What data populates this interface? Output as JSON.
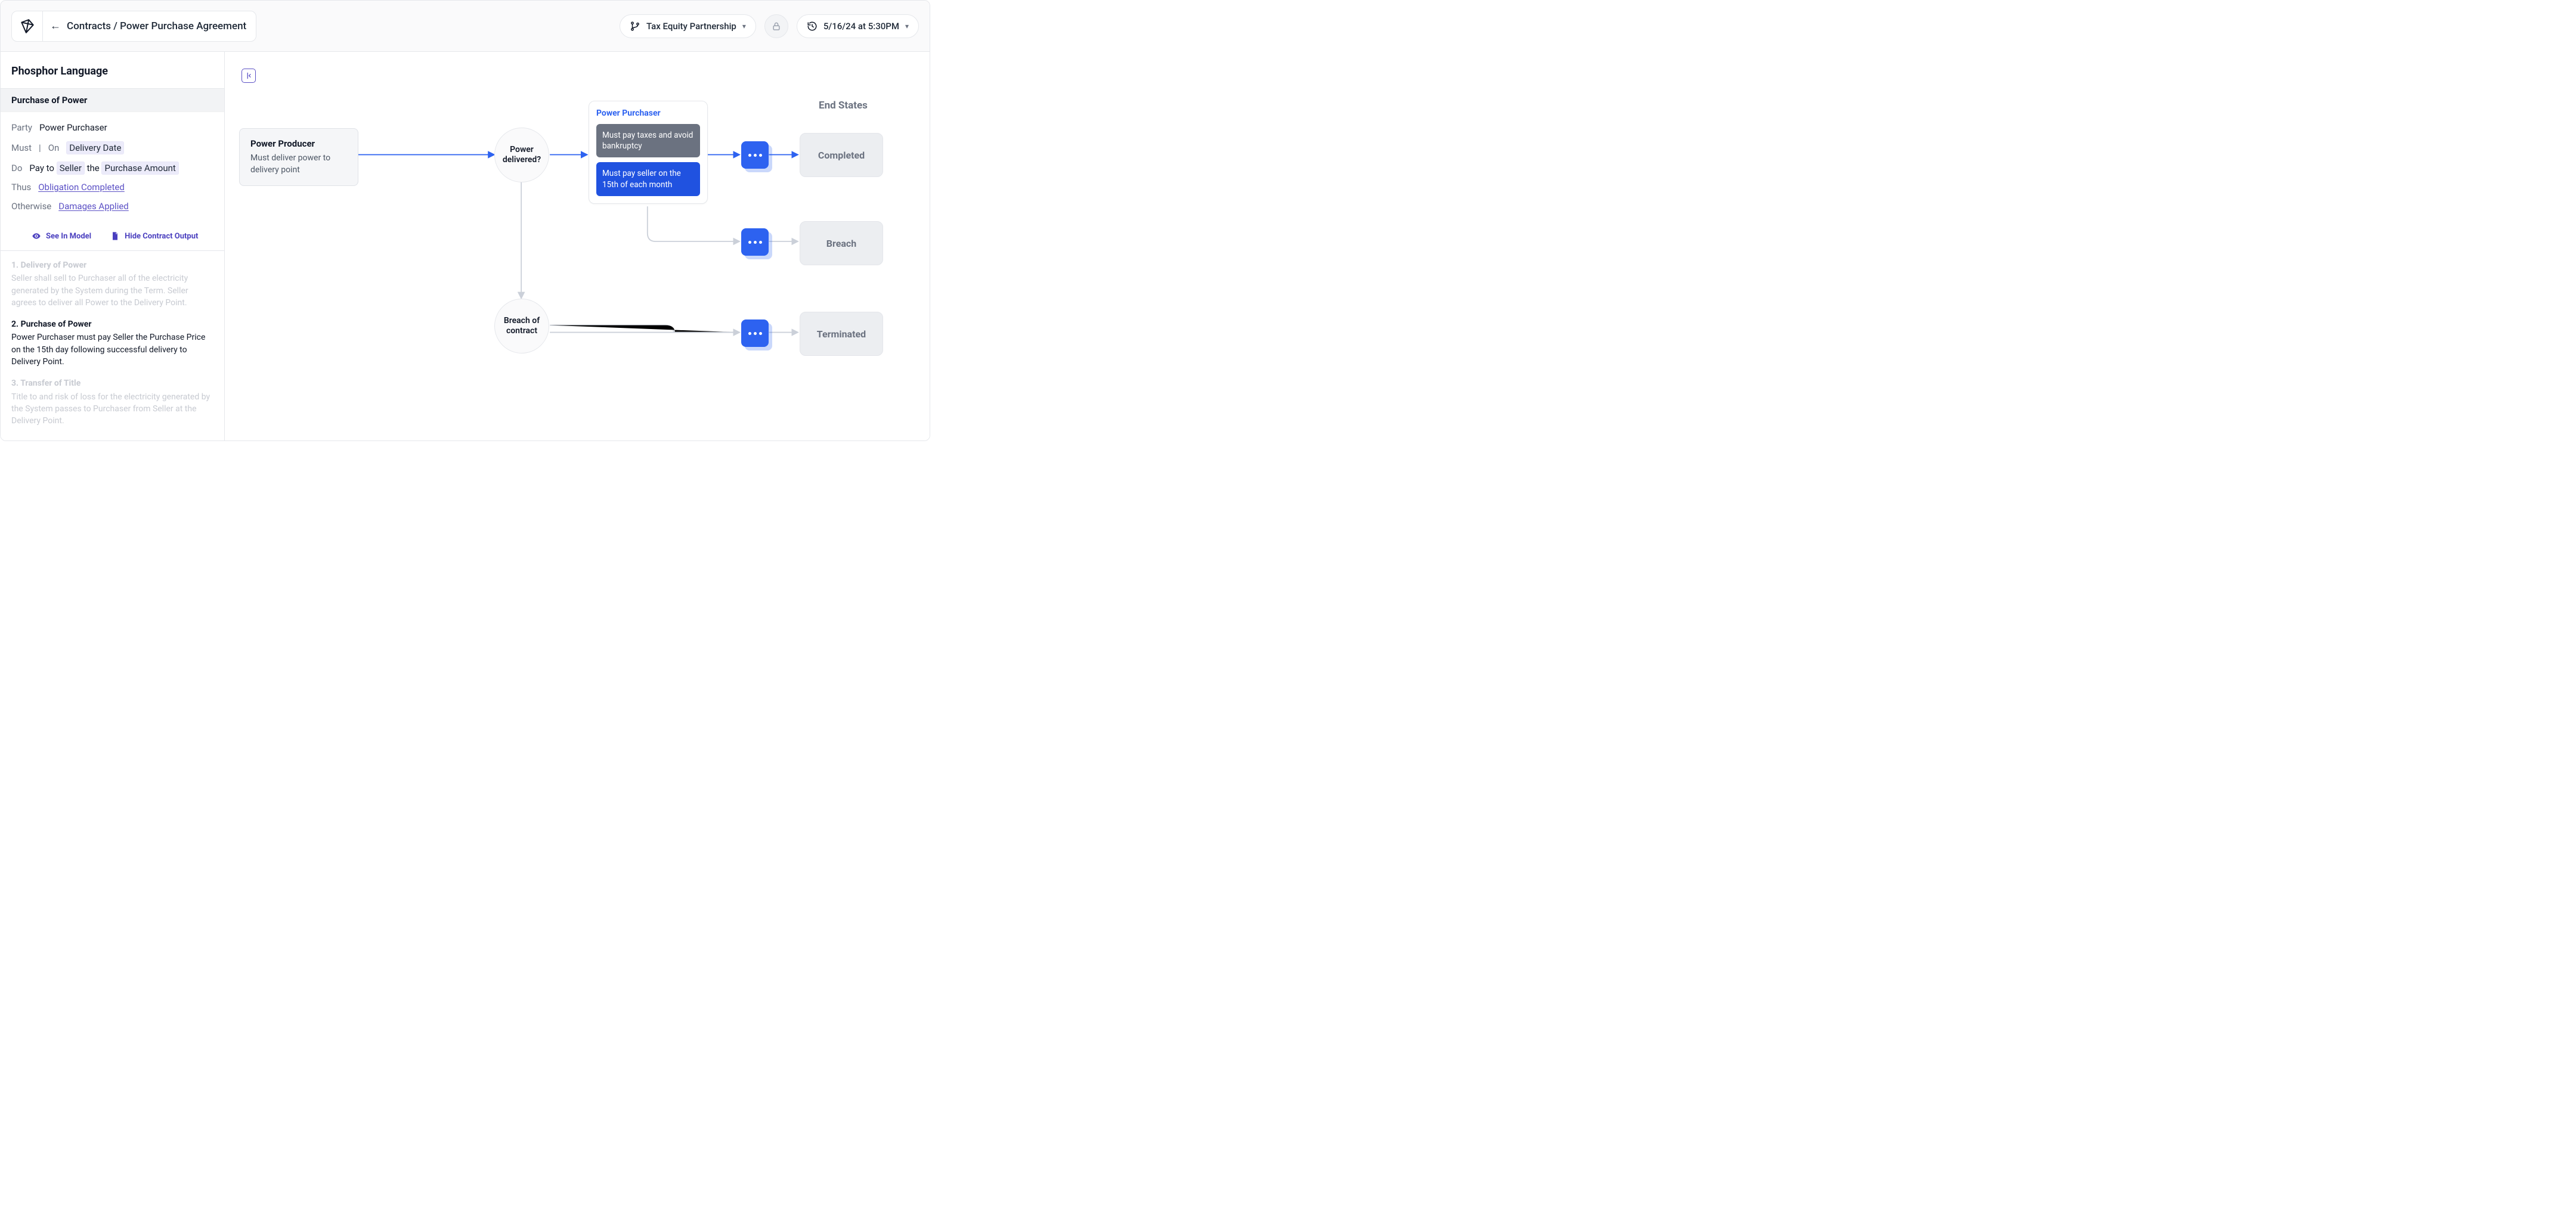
{
  "header": {
    "breadcrumb_prefix": "Contracts",
    "breadcrumb_sep": " / ",
    "breadcrumb_current": "Power Purchase Agreement",
    "branch_label": "Tax Equity Partnership",
    "timestamp": "5/16/24 at 5:30PM"
  },
  "sidebar": {
    "title": "Phosphor Language",
    "section": "Purchase of Power",
    "rows": {
      "party_k": "Party",
      "party_v": "Power Purchaser",
      "must_k": "Must",
      "on_k": "On",
      "on_v": "Delivery Date",
      "do_k": "Do",
      "do_pre": "Pay to ",
      "do_chip1": "Seller",
      "do_mid": " the ",
      "do_chip2": "Purchase Amount",
      "thus_k": "Thus",
      "thus_v": "Obligation Completed",
      "otherwise_k": "Otherwise",
      "otherwise_v": "Damages Applied"
    },
    "actions": {
      "see_in_model": "See In Model",
      "hide_output": "Hide Contract Output"
    },
    "clauses": [
      {
        "title": "1. Delivery of Power",
        "body": "Seller shall sell to Purchaser all of the electricity generated by the System during the Term. Seller agrees to deliver all Power to the Delivery Point.",
        "active": false
      },
      {
        "title": "2. Purchase of Power",
        "body": "Power Purchaser must pay Seller the Purchase Price on the 15th day following successful delivery to Delivery Point.",
        "active": true
      },
      {
        "title": "3. Transfer of Title",
        "body": "Title to and risk of loss for the electricity generated by the System passes to Purchaser from Seller at the Delivery Point.",
        "active": false
      }
    ]
  },
  "diagram": {
    "end_states_label": "End States",
    "producer": {
      "title": "Power Producer",
      "desc": "Must deliver power to delivery point"
    },
    "decision1": "Power delivered?",
    "decision2": "Breach of contract",
    "panel": {
      "title": "Power Purchaser",
      "card1": "Must pay taxes and avoid bankruptcy",
      "card2": "Must pay seller on the 15th of each month"
    },
    "end": {
      "completed": "Completed",
      "breach": "Breach",
      "terminated": "Terminated"
    }
  }
}
